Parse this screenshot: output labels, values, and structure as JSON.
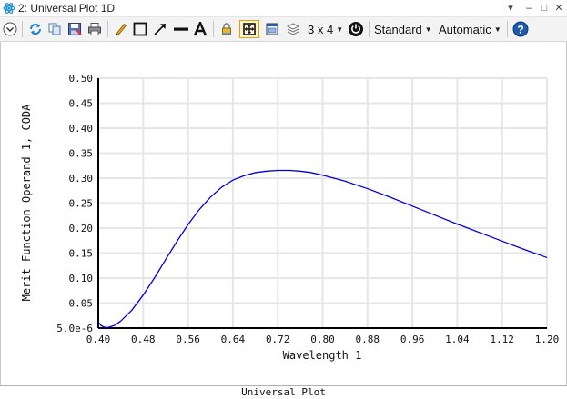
{
  "window": {
    "title": "2: Universal Plot 1D",
    "pin_glyph": "▾",
    "minimize_glyph": "–",
    "restore_glyph": "□",
    "close_glyph": "✕"
  },
  "toolbar": {
    "layout_label": "3 x 4",
    "standard_label": "Standard",
    "automatic_label": "Automatic"
  },
  "tab": {
    "label": "Universal Plot"
  },
  "colors": {
    "curve": "#0000dd",
    "grid": "#e6e6e6",
    "highlight": "#e8a000",
    "help": "#1e5aa8"
  },
  "chart_data": {
    "type": "line",
    "title": "",
    "xlabel": "Wavelength 1",
    "ylabel": "Merit Function Operand 1, CODA",
    "xlim": [
      0.4,
      1.2
    ],
    "ylim": [
      5e-06,
      0.5
    ],
    "xticks": [
      "0.40",
      "0.48",
      "0.56",
      "0.64",
      "0.72",
      "0.80",
      "0.88",
      "0.96",
      "1.04",
      "1.12",
      "1.20"
    ],
    "yticks": [
      "5.0e-6",
      "0.05",
      "0.10",
      "0.15",
      "0.20",
      "0.25",
      "0.30",
      "0.35",
      "0.40",
      "0.45",
      "0.50"
    ],
    "grid": true,
    "series": [
      {
        "x": [
          0.4,
          0.405,
          0.41,
          0.415,
          0.42,
          0.43,
          0.44,
          0.46,
          0.48,
          0.5,
          0.52,
          0.54,
          0.56,
          0.58,
          0.6,
          0.62,
          0.64,
          0.66,
          0.68,
          0.7,
          0.72,
          0.74,
          0.76,
          0.78,
          0.8,
          0.84,
          0.88,
          0.92,
          0.96,
          1.0,
          1.04,
          1.08,
          1.12,
          1.16,
          1.2
        ],
        "y": [
          0.012,
          0.005,
          0.002,
          0.0012,
          0.002,
          0.006,
          0.014,
          0.036,
          0.066,
          0.1,
          0.137,
          0.173,
          0.207,
          0.237,
          0.262,
          0.282,
          0.296,
          0.305,
          0.311,
          0.314,
          0.3155,
          0.3155,
          0.314,
          0.311,
          0.306,
          0.294,
          0.279,
          0.262,
          0.244,
          0.226,
          0.208,
          0.191,
          0.174,
          0.157,
          0.141
        ]
      }
    ]
  }
}
